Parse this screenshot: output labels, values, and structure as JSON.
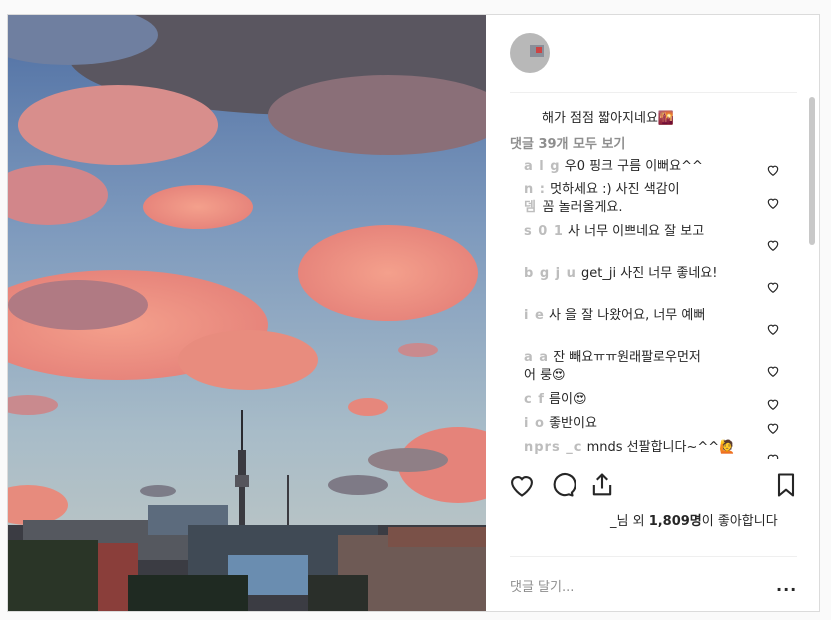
{
  "post": {
    "caption": "해가 점점 짧아지네요🌇",
    "view_all": "댓글 39개 모두 보기",
    "likes_prefix": "_님 외 ",
    "likes_count": "1,809명",
    "likes_suffix": "이 좋아합니다",
    "add_comment_placeholder": "댓글 달기...",
    "more": "..."
  },
  "comments": [
    {
      "user": "a l  g",
      "text": "우0 핑크 구름 이뻐요^^"
    },
    {
      "user": "n  :",
      "text": "멋하세요 :) 사진 색감이"
    },
    {
      "user": "뎀    ",
      "text": "꼼 놀러올게요."
    },
    {
      "user": "s 0  1",
      "text": "사  너무 이쁘네요 잘 보고"
    },
    {
      "user": "      ",
      "text": ""
    },
    {
      "user": "b  g  j u",
      "text": "get_ji 사진 너무 좋네요!"
    },
    {
      "user": "i  e",
      "text": "사  을 잘 나왔어요, 너무 예뻐"
    },
    {
      "user": "a  a",
      "text": "잔 빼요ㅠㅠ원래팔로우먼저"
    },
    {
      "user": "",
      "text": "어 룽😍"
    },
    {
      "user": "c  f",
      "text": "름이😍"
    },
    {
      "user": "i  o",
      "text": "좋반이요"
    },
    {
      "user": "nprs _c",
      "text": "mnds 선팔합니다~^^🙋"
    }
  ],
  "colors": {
    "border": "#dbdbdb",
    "text": "#262626",
    "muted": "#8e8e8e"
  },
  "icons": [
    "heart-icon",
    "comment-icon",
    "share-icon",
    "bookmark-icon",
    "more-icon"
  ]
}
